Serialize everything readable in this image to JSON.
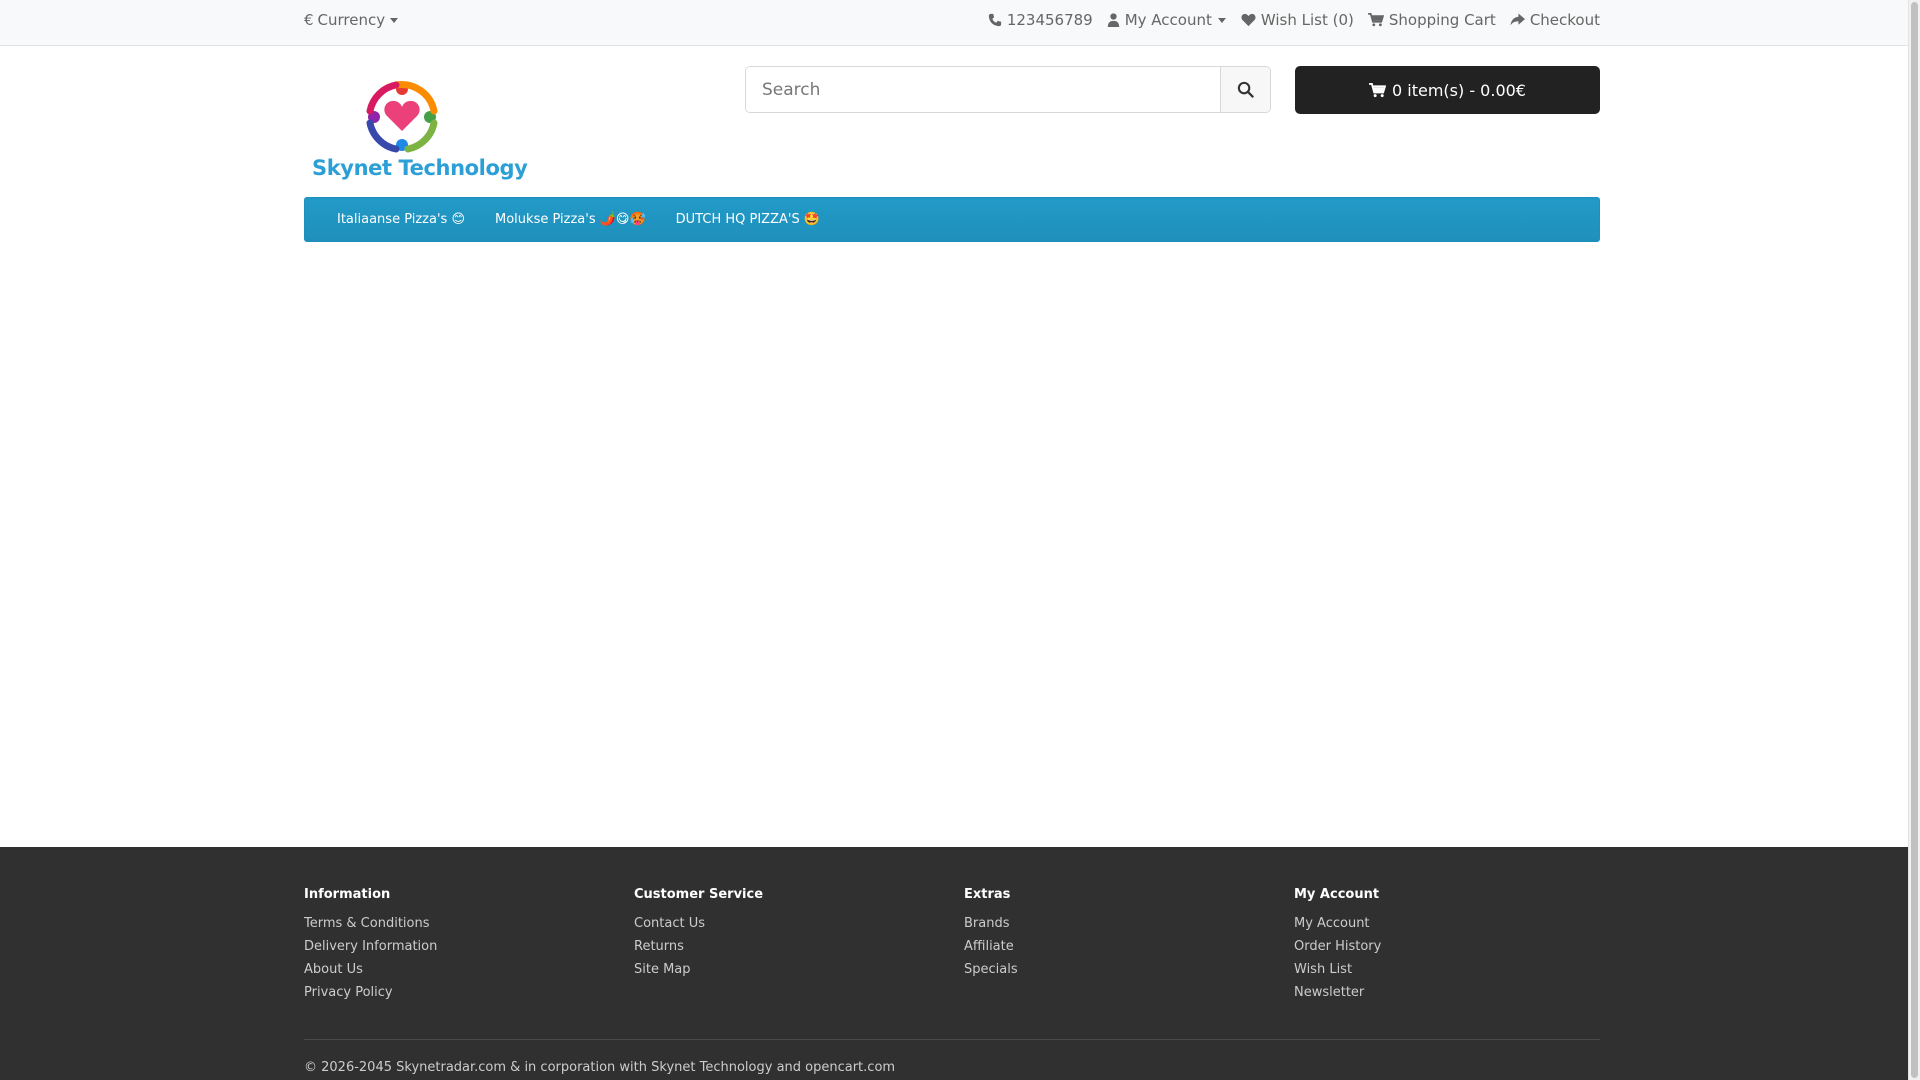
{
  "topbar": {
    "currency_symbol": "€",
    "currency_label": "Currency",
    "phone": "123456789",
    "my_account": "My Account",
    "wishlist": "Wish List (0)",
    "shopping_cart": "Shopping Cart",
    "checkout": "Checkout"
  },
  "header": {
    "brand_name": "Skynet Technology",
    "search_placeholder": "Search",
    "cart_button": "0 item(s) - 0.00€"
  },
  "menu": {
    "items": [
      "Italiaanse Pizza's 😊",
      "Molukse Pizza's 🌶️😋🥵",
      "DUTCH HQ PIZZA'S 🤩"
    ]
  },
  "footer": {
    "columns": [
      {
        "title": "Information",
        "links": [
          "Terms & Conditions",
          "Delivery Information",
          "About Us",
          "Privacy Policy"
        ]
      },
      {
        "title": "Customer Service",
        "links": [
          "Contact Us",
          "Returns",
          "Site Map"
        ]
      },
      {
        "title": "Extras",
        "links": [
          "Brands",
          "Affiliate",
          "Specials"
        ]
      },
      {
        "title": "My Account",
        "links": [
          "My Account",
          "Order History",
          "Wish List",
          "Newsletter"
        ]
      }
    ],
    "copyright": "© 2026-2045 Skynetradar.com & in corporation with Skynet Technology and opencart.com"
  },
  "colors": {
    "menu_blue": "#229ac8",
    "footer_bg": "#303030",
    "cart_bg": "#222222",
    "brand_blue": "#2c9fd6"
  }
}
